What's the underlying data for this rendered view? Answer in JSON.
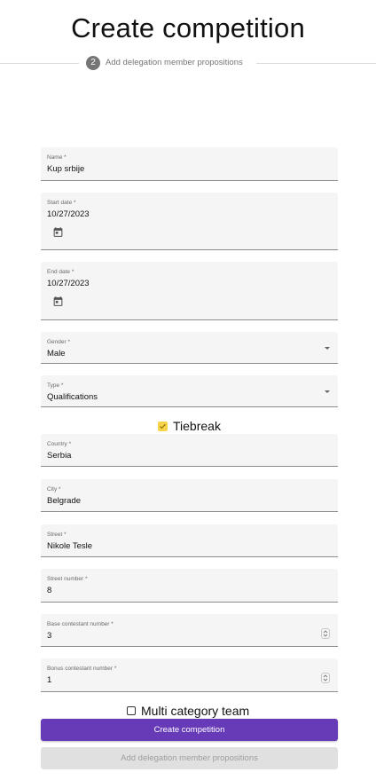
{
  "page": {
    "title": "Create competition"
  },
  "stepper": {
    "step_number": "2",
    "step_label": "Add delegation member propositions"
  },
  "form": {
    "name": {
      "label": "Name *",
      "value": "Kup srbije"
    },
    "start_date": {
      "label": "Start date *",
      "value": "10/27/2023",
      "icon": "calendar-icon"
    },
    "end_date": {
      "label": "End date *",
      "value": "10/27/2023",
      "icon": "calendar-icon"
    },
    "gender": {
      "label": "Gender *",
      "value": "Male"
    },
    "type": {
      "label": "Type *",
      "value": "Qualifications"
    },
    "tiebreak": {
      "label": "Tiebreak",
      "checked": true
    },
    "country": {
      "label": "Country *",
      "value": "Serbia"
    },
    "city": {
      "label": "City *",
      "value": "Belgrade"
    },
    "street": {
      "label": "Street *",
      "value": "Nikole Tesle"
    },
    "street_number": {
      "label": "Street number *",
      "value": "8"
    },
    "base_contestant_number": {
      "label": "Base contestant number *",
      "value": "3"
    },
    "bonus_contestant_number": {
      "label": "Bonus contestant number *",
      "value": "1"
    },
    "multi_category_team": {
      "label": "Multi category team",
      "checked": false
    }
  },
  "actions": {
    "create_label": "Create competition",
    "add_delegation_label": "Add delegation member propositions"
  },
  "colors": {
    "primary": "#673ab7",
    "checkbox_accent": "#f7d34a",
    "field_bg": "#f5f5f5"
  }
}
